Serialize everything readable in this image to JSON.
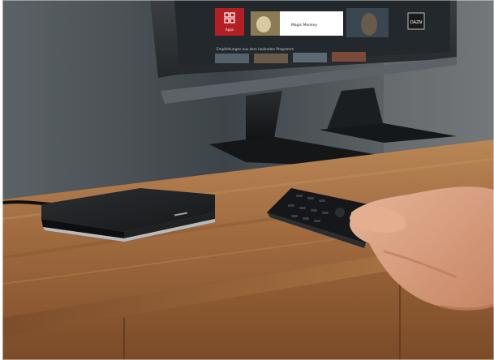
{
  "tv_screen": {
    "tiles": [
      {
        "label": "Apps",
        "icon": "grid-icon",
        "color": "#b31f25"
      },
      {
        "label": "Magic Monkey",
        "icon": "poster-image",
        "color": "#ffffff"
      },
      {
        "label": "DAZN",
        "icon": "dazn-logo",
        "color": "#1a1a1a"
      }
    ],
    "section_title": "Empfehlungen aus dem laufenden Programm",
    "background_color": "#2a2f33"
  },
  "set_top_box": {
    "brand_mark": "",
    "body_color": "#1b1d1f"
  },
  "remote_control": {
    "body_color": "#17191b"
  },
  "colors": {
    "wall": "#434a4f",
    "wood": "#a16a3f",
    "wood_highlight": "#c08a57",
    "skin": "#d9a184"
  }
}
